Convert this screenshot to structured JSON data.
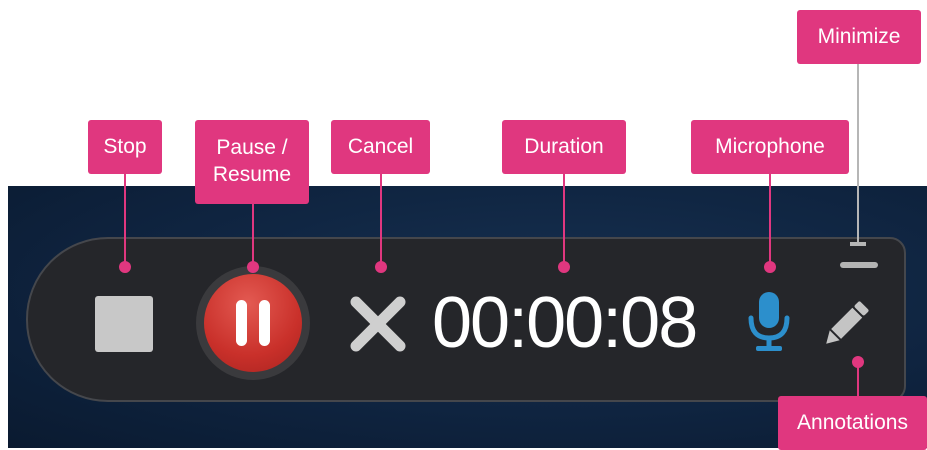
{
  "toolbar": {
    "duration": "00:00:08",
    "controls": {
      "stop": "stop-icon",
      "pause": "pause-icon",
      "cancel": "close-icon",
      "microphone": "microphone-icon",
      "annotations": "pencil-icon",
      "minimize": "minimize-icon"
    },
    "colors": {
      "bar_bg": "#25262a",
      "pause_red": "#c9302a",
      "mic_blue": "#2c8fcc",
      "callout_pink": "#e0377f"
    }
  },
  "callouts": {
    "stop": "Stop",
    "pause_line1": "Pause /",
    "pause_line2": "Resume",
    "cancel": "Cancel",
    "duration": "Duration",
    "microphone": "Microphone",
    "minimize": "Minimize",
    "annotations": "Annotations"
  }
}
